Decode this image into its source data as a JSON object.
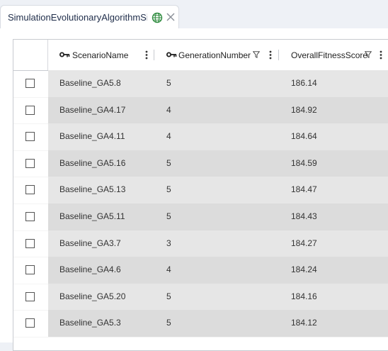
{
  "tab": {
    "title": "SimulationEvolutionaryAlgorithmSi"
  },
  "columns": [
    {
      "label": "ScenarioName",
      "key": true
    },
    {
      "label": "GenerationNumber",
      "key": true
    },
    {
      "label": "OverallFitnessScore",
      "key": false
    }
  ],
  "rows": [
    {
      "scenario": "Baseline_GA5.8",
      "generation": "5",
      "fitness": "186.14"
    },
    {
      "scenario": "Baseline_GA4.17",
      "generation": "4",
      "fitness": "184.92"
    },
    {
      "scenario": "Baseline_GA4.11",
      "generation": "4",
      "fitness": "184.64"
    },
    {
      "scenario": "Baseline_GA5.16",
      "generation": "5",
      "fitness": "184.59"
    },
    {
      "scenario": "Baseline_GA5.13",
      "generation": "5",
      "fitness": "184.47"
    },
    {
      "scenario": "Baseline_GA5.11",
      "generation": "5",
      "fitness": "184.43"
    },
    {
      "scenario": "Baseline_GA3.7",
      "generation": "3",
      "fitness": "184.27"
    },
    {
      "scenario": "Baseline_GA4.6",
      "generation": "4",
      "fitness": "184.24"
    },
    {
      "scenario": "Baseline_GA5.20",
      "generation": "5",
      "fitness": "184.16"
    },
    {
      "scenario": "Baseline_GA5.3",
      "generation": "5",
      "fitness": "184.12"
    }
  ]
}
